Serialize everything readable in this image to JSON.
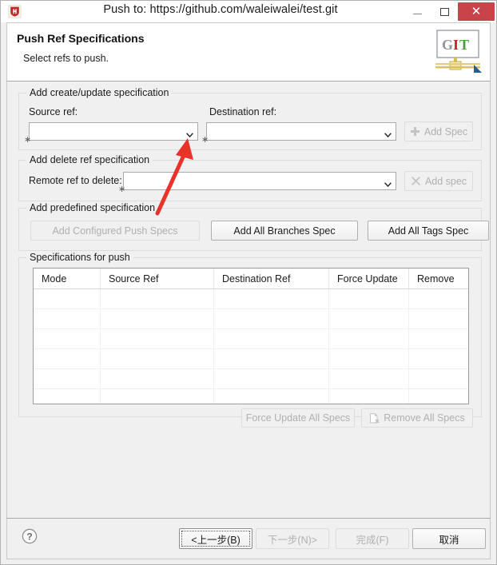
{
  "window": {
    "title": "Push to: https://github.com/waleiwalei/test.git",
    "app_icon": "h-shield-icon",
    "controls": {
      "minimize": "minimize-icon",
      "maximize": "maximize-icon",
      "close": "✕"
    }
  },
  "header": {
    "title": "Push Ref Specifications",
    "subtitle": "Select refs to push.",
    "logo": {
      "letters": [
        "G",
        "I",
        "T"
      ],
      "colors": [
        "#8f9296",
        "#cc2127",
        "#4a9d3f"
      ]
    }
  },
  "groups": {
    "create_update": {
      "label": "Add create/update specification",
      "source_ref_label": "Source ref:",
      "source_ref_value": "",
      "source_ref_placeholder": "",
      "destination_ref_label": "Destination ref:",
      "destination_ref_value": "",
      "destination_ref_placeholder": "",
      "add_spec_button": "Add Spec",
      "add_spec_icon": "plus-icon",
      "required_marker": "∗"
    },
    "delete_ref": {
      "label": "Add delete ref specification",
      "remote_ref_label": "Remote ref to delete:",
      "remote_ref_value": "",
      "remote_ref_placeholder": "",
      "add_spec_button": "Add spec",
      "add_spec_icon": "cross-icon",
      "required_marker": "∗"
    },
    "predefined": {
      "label": "Add predefined specification",
      "buttons": [
        {
          "label": "Add Configured Push Specs",
          "enabled": false
        },
        {
          "label": "Add All Branches Spec",
          "enabled": true
        },
        {
          "label": "Add All Tags Spec",
          "enabled": true
        }
      ]
    },
    "specs_for_push": {
      "label": "Specifications for push",
      "columns": [
        "Mode",
        "Source Ref",
        "Destination Ref",
        "Force Update",
        "Remove"
      ],
      "rows": [],
      "empty_row_count": 6,
      "force_update_all_button": "Force Update All Specs",
      "remove_all_button": "Remove All Specs",
      "remove_all_icon": "remove-document-icon"
    }
  },
  "footer": {
    "help_icon": "help-question-icon",
    "buttons": [
      {
        "label": "<上一步(B)",
        "enabled": true,
        "focused": true
      },
      {
        "label": "下一步(N)>",
        "enabled": false,
        "focused": false
      },
      {
        "label": "完成(F)",
        "enabled": false,
        "focused": false
      },
      {
        "label": "取消",
        "enabled": true,
        "focused": false
      }
    ]
  },
  "annotation": {
    "type": "red-arrow",
    "color": "#e8322a",
    "points_to": "source-ref-combo-arrow"
  }
}
